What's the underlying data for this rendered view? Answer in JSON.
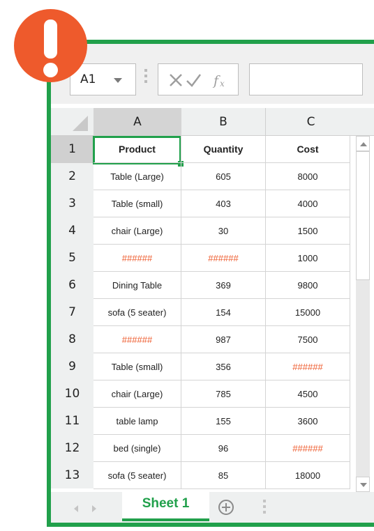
{
  "colors": {
    "accent": "#21a04b",
    "error": "#ee5a2c"
  },
  "alert_icon": "exclamation-icon",
  "formula_bar": {
    "name_box": "A1",
    "icons": [
      "cancel-icon",
      "enter-icon",
      "fx-icon"
    ],
    "formula_value": ""
  },
  "columns": [
    "A",
    "B",
    "C"
  ],
  "rows": [
    {
      "num": "1",
      "cells": [
        "Product",
        "Quantity",
        "Cost"
      ]
    },
    {
      "num": "2",
      "cells": [
        "Table (Large)",
        "605",
        "8000"
      ]
    },
    {
      "num": "3",
      "cells": [
        "Table (small)",
        "403",
        "4000"
      ]
    },
    {
      "num": "4",
      "cells": [
        "chair (Large)",
        "30",
        "1500"
      ]
    },
    {
      "num": "5",
      "cells": [
        "######",
        "######",
        "1000"
      ]
    },
    {
      "num": "6",
      "cells": [
        "Dining Table",
        "369",
        "9800"
      ]
    },
    {
      "num": "7",
      "cells": [
        "sofa (5 seater)",
        "154",
        "15000"
      ]
    },
    {
      "num": "8",
      "cells": [
        "######",
        "987",
        "7500"
      ]
    },
    {
      "num": "9",
      "cells": [
        "Table (small)",
        "356",
        "######"
      ]
    },
    {
      "num": "10",
      "cells": [
        "chair (Large)",
        "785",
        "4500"
      ]
    },
    {
      "num": "11",
      "cells": [
        "table lamp",
        "155",
        "3600"
      ]
    },
    {
      "num": "12",
      "cells": [
        "bed (single)",
        "96",
        "######"
      ]
    },
    {
      "num": "13",
      "cells": [
        "sofa (5 seater)",
        "85",
        "18000"
      ]
    }
  ],
  "selected_cell": "A1",
  "sheet_tabs": {
    "active": "Sheet 1",
    "add_icon": "plus-circle-icon"
  }
}
